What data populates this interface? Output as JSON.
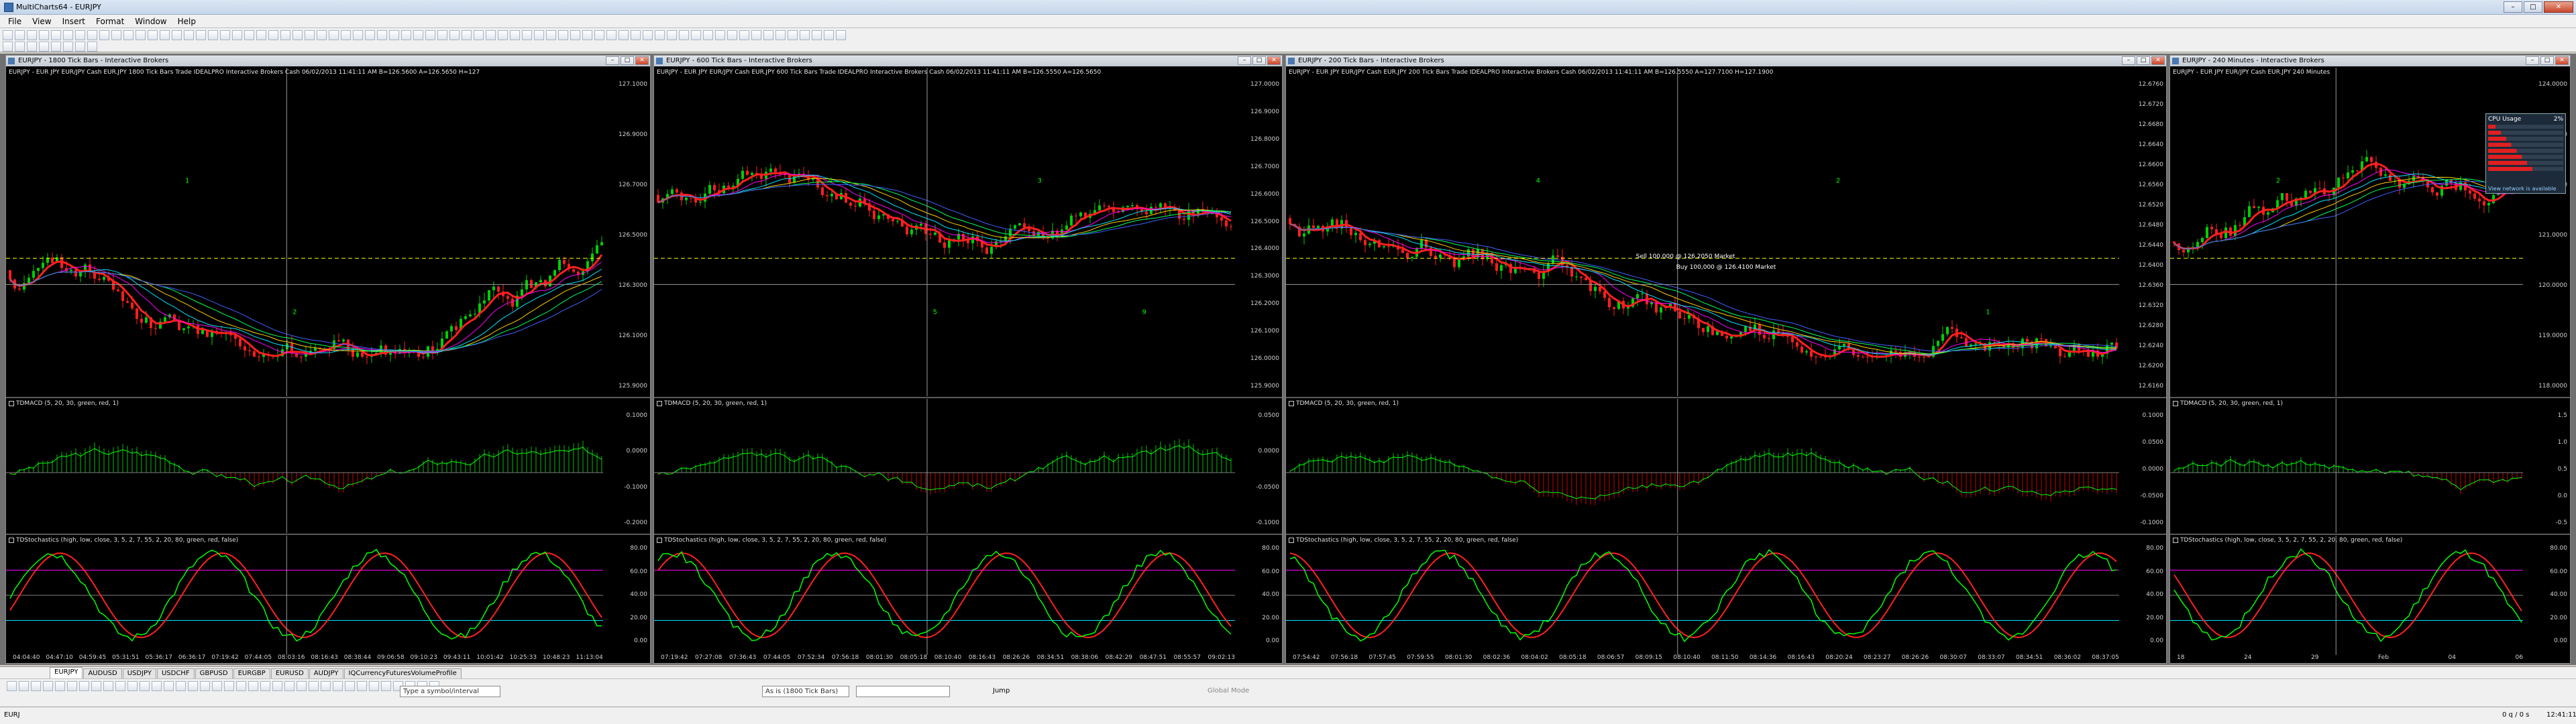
{
  "app": {
    "title": "MultiCharts64 - EURJPY"
  },
  "menu": [
    "File",
    "View",
    "Insert",
    "Format",
    "Window",
    "Help"
  ],
  "icons": {
    "app": "multicharts-icon",
    "close": "close-icon",
    "maximize": "maximize-icon",
    "minimize": "minimize-icon",
    "indicator_toggle": "checkbox-icon"
  },
  "colors": {
    "chart_bg": "#000000",
    "up_candle": "#00d000",
    "down_candle": "#ff1e1e",
    "macd_up": "#00c000",
    "macd_down": "#d00000",
    "stoch_k": "#00ff00",
    "stoch_d": "#ff2020"
  },
  "charts": [
    {
      "window_title": "EURJPY - 1800 Tick Bars - Interactive Brokers",
      "header": "EURJPY - EUR JPY EUR/JPY Cash EUR.JPY  1800 Tick Bars     Trade  IDEALPRO  Interactive Brokers  Cash  06/02/2013  11:41:11 AM  B=126.5600  A=126.5650  H=127",
      "price_ticks": [
        "127.1000",
        "126.9000",
        "126.7000",
        "126.5000",
        "126.3000",
        "126.1000",
        "125.9000"
      ],
      "macd_label": "TDMACD (5, 20, 30, green, red, 1)",
      "macd_ticks": [
        "0.1000",
        "0.0000",
        "-0.1000",
        "-0.2000"
      ],
      "stoch_label": "TDStochastics (high, low, close, 3, 5, 2, 7, 55, 2, 20, 80, green, red, false)",
      "stoch_ticks": [
        "80.00",
        "60.00",
        "40.00",
        "20.00",
        "0.00"
      ],
      "time_ticks": [
        "04:04:40",
        "04:47:10",
        "04:59:45",
        "05:31:51",
        "05:36:17",
        "06:36:17",
        "07:19:42",
        "07:44:05",
        "08:03:16",
        "08:16:43",
        "08:38:44",
        "09:06:58",
        "09:10:23",
        "09:43:11",
        "10:01:42",
        "10:25:33",
        "10:48:23",
        "11:13:04"
      ],
      "wave_labels": [
        "1",
        "2"
      ]
    },
    {
      "window_title": "EURJPY - 600 Tick Bars - Interactive Brokers",
      "header": "EURJPY - EUR JPY EUR/JPY Cash EUR.JPY  600 Tick Bars     Trade  IDEALPRO  Interactive Brokers  Cash  06/02/2013  11:41:11 AM  B=126.5550  A=126.5650",
      "price_ticks": [
        "127.0000",
        "126.9000",
        "126.8000",
        "126.7000",
        "126.6000",
        "126.5000",
        "126.4000",
        "126.3000",
        "126.2000",
        "126.1000",
        "126.0000",
        "125.9000"
      ],
      "macd_label": "TDMACD (5, 20, 30, green, red, 1)",
      "macd_ticks": [
        "0.0500",
        "0.0000",
        "-0.0500",
        "-0.1000"
      ],
      "stoch_label": "TDStochastics (high, low, close, 3, 5, 2, 7, 55, 2, 20, 80, green, red, false)",
      "stoch_ticks": [
        "80.00",
        "60.00",
        "40.00",
        "20.00",
        "0.00"
      ],
      "time_ticks": [
        "07:19:42",
        "07:27:08",
        "07:36:43",
        "07:44:05",
        "07:52:34",
        "07:56:18",
        "08:01:30",
        "08:05:18",
        "08:10:40",
        "08:16:43",
        "08:26:26",
        "08:34:51",
        "08:38:06",
        "08:42:29",
        "08:47:51",
        "08:55:57",
        "09:02:13"
      ],
      "wave_labels": [
        "4",
        "5",
        "3",
        "9"
      ]
    },
    {
      "window_title": "EURJPY - 200 Tick Bars - Interactive Brokers",
      "header": "EURJPY - EUR JPY EUR/JPY Cash EUR.JPY  200 Tick Bars     Trade  IDEALPRO  Interactive Brokers  Cash  06/02/2013  11:41:11 AM  B=126.5550  A=127.7100  H=127.1900",
      "price_ticks": [
        "12.6760",
        "12.6720",
        "12.6680",
        "12.6640",
        "12.6600",
        "12.6560",
        "12.6520",
        "12.6480",
        "12.6440",
        "12.6400",
        "12.6360",
        "12.6320",
        "12.6280",
        "12.6240",
        "12.6200",
        "12.6160"
      ],
      "macd_label": "TDMACD (5, 20, 30, green, red, 1)",
      "macd_ticks": [
        "0.1000",
        "0.0500",
        "0.0000",
        "-0.0500",
        "-0.1000"
      ],
      "stoch_label": "TDStochastics (high, low, close, 3, 5, 2, 7, 55, 2, 20, 80, green, red, false)",
      "stoch_ticks": [
        "80.00",
        "60.00",
        "40.00",
        "20.00",
        "0.00"
      ],
      "time_ticks": [
        "07:54:42",
        "07:56:18",
        "07:57:45",
        "07:59:55",
        "08:01:30",
        "08:02:36",
        "08:04:02",
        "08:05:18",
        "08:06:57",
        "08:09:15",
        "08:10:40",
        "08:11:50",
        "08:14:36",
        "08:16:43",
        "08:20:24",
        "08:23:27",
        "08:26:26",
        "08:30:07",
        "08:33:07",
        "08:34:51",
        "08:36:02",
        "08:37:05"
      ],
      "annotations": [
        "Sell 100,000 @ 126.2050 Market",
        "Buy 100,000 @ 126.4100 Market"
      ],
      "wave_labels": [
        "4",
        "1",
        "2",
        "1"
      ]
    },
    {
      "window_title": "EURJPY - 240 Minutes - Interactive Brokers",
      "header": "EURJPY - EUR JPY EUR/JPY Cash EUR.JPY  240 Minutes",
      "price_ticks": [
        "124.0000",
        "123.0000",
        "122.0000",
        "121.0000",
        "120.0000",
        "119.0000",
        "118.0000"
      ],
      "macd_label": "TDMACD (5, 20, 30, green, red, 1)",
      "macd_ticks": [
        "1.5",
        "1.0",
        "0.5",
        "0.0",
        "-0.5"
      ],
      "stoch_label": "TDStochastics (high, low, close, 3, 5, 2, 7, 55, 2, 20, 80, green, red, false)",
      "stoch_ticks": [
        "80.00",
        "60.00",
        "40.00",
        "20.00",
        "0.00"
      ],
      "time_ticks": [
        "18",
        "24",
        "29",
        "Feb",
        "04",
        "06"
      ],
      "cpu_widget": {
        "title": "CPU Usage",
        "value": "2%",
        "footer": "View network is available"
      },
      "wave_labels": [
        "2"
      ]
    }
  ],
  "tabs": [
    "EURJPY",
    "AUDUSD",
    "USDJPY",
    "USDCHF",
    "GBPUSD",
    "EURGBP",
    "EURUSD",
    "AUDJPY",
    "IQCurrencyFuturesVolumeProfile"
  ],
  "drawbar": {
    "symbol_placeholder": "Type a symbol/interval",
    "resolution": "As is (1800 Tick Bars)",
    "jump": "Jump",
    "global_mode": "Global Mode"
  },
  "status": {
    "symbol": "EURJ",
    "counter": "0 q / 0 s",
    "clock": "12:41:11"
  }
}
